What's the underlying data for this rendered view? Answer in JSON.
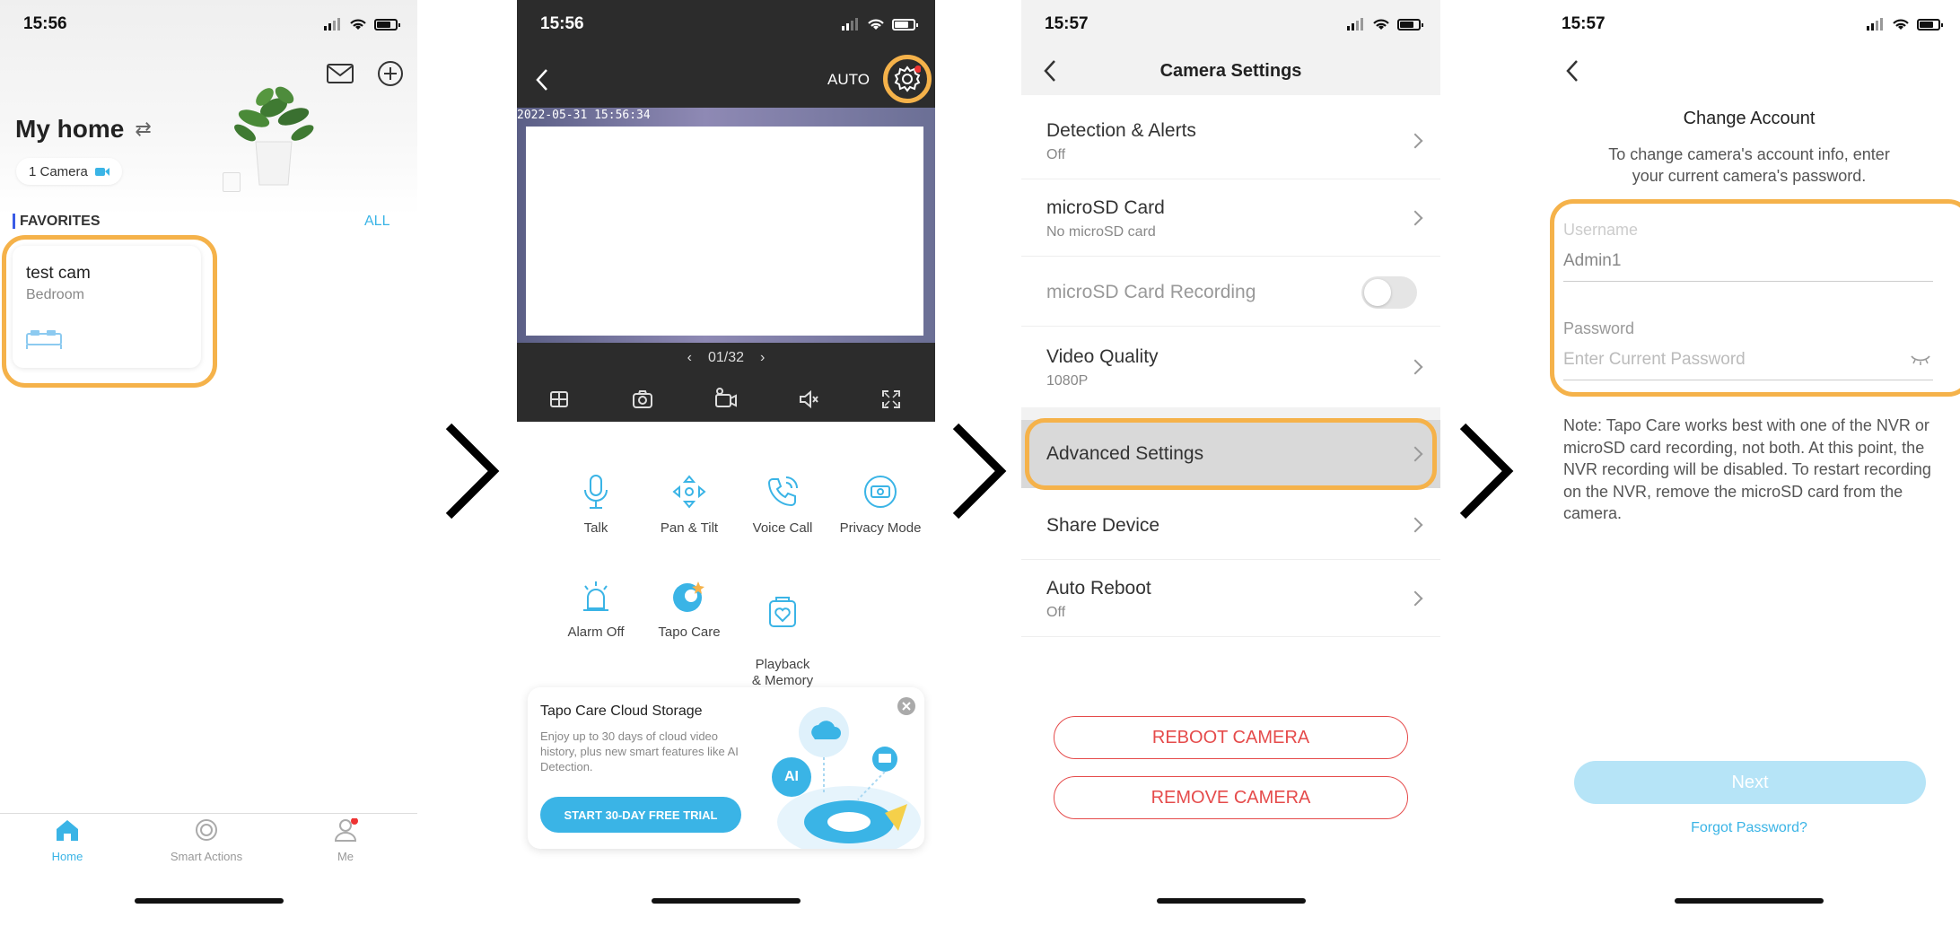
{
  "screen1": {
    "time": "15:56",
    "title": "My home",
    "camera_count": "1 Camera",
    "favorites": "FAVORITES",
    "all": "ALL",
    "device_name": "test cam",
    "device_room": "Bedroom",
    "tabs": [
      {
        "label": "Home"
      },
      {
        "label": "Smart Actions"
      },
      {
        "label": "Me"
      }
    ]
  },
  "screen2": {
    "time": "15:56",
    "mode": "AUTO",
    "timestamp": "2022-05-31 15:56:34",
    "page": "01/32",
    "controls": [
      {
        "label": "Talk"
      },
      {
        "label": "Pan & Tilt"
      },
      {
        "label": "Voice Call"
      },
      {
        "label": "Privacy Mode"
      },
      {
        "label": "Alarm Off"
      },
      {
        "label": "Tapo Care"
      },
      {
        "label": "Playback\n& Memory"
      }
    ],
    "promo_title": "Tapo Care Cloud Storage",
    "promo_text": "Enjoy up to 30 days of cloud video history, plus new smart features like AI Detection.",
    "promo_button": "START 30-DAY FREE TRIAL",
    "ai_badge": "AI"
  },
  "screen3": {
    "time": "15:57",
    "title": "Camera Settings",
    "rows": [
      {
        "title": "Detection & Alerts",
        "sub": "Off"
      },
      {
        "title": "microSD Card",
        "sub": "No microSD card"
      },
      {
        "title": "microSD Card Recording"
      },
      {
        "title": "Video Quality",
        "sub": "1080P"
      },
      {
        "title": "Advanced Settings"
      },
      {
        "title": "Share Device"
      },
      {
        "title": "Auto Reboot",
        "sub": "Off"
      }
    ],
    "reboot": "REBOOT CAMERA",
    "remove": "REMOVE CAMERA"
  },
  "screen4": {
    "time": "15:57",
    "title": "Change Account",
    "subtitle": "To change camera's account info, enter your current camera's password.",
    "username_label": "Username",
    "username_value": "Admin1",
    "password_label": "Password",
    "password_placeholder": "Enter Current Password",
    "note": "Note: Tapo Care works best with one of the NVR or microSD card recording, not both. At this point, the NVR recording will be disabled. To restart recording on the NVR, remove the microSD card from the camera.",
    "next": "Next",
    "forgot": "Forgot Password?"
  },
  "colors": {
    "highlight": "#f5b24a",
    "accent": "#3ab4e6",
    "danger": "#e54b4b"
  }
}
